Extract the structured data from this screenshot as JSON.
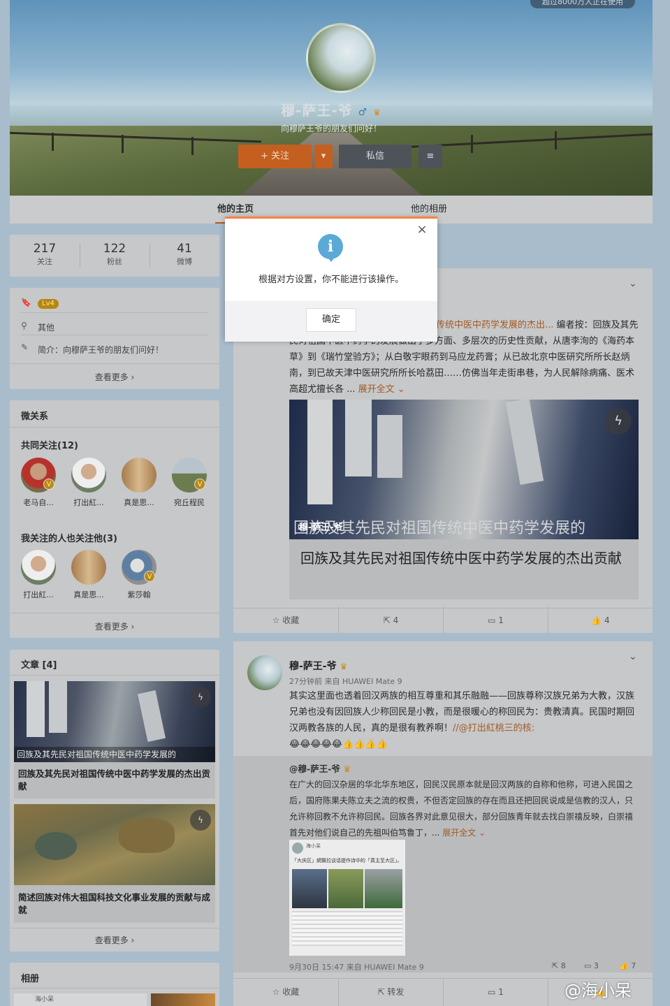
{
  "cover": {
    "top_badge": "超过8000万人正在使用",
    "username": "穆-萨王-爷",
    "gender_icon": "male-icon",
    "tagline": "向穆萨王爷的朋友们问好！",
    "follow_label": "+ 关注",
    "follow_dropdown": "▾",
    "message_label": "私信",
    "menu_label": "≡"
  },
  "tabs": [
    {
      "label": "他的主页"
    },
    {
      "label": "他的相册"
    }
  ],
  "stats": [
    {
      "value": "217",
      "label": "关注"
    },
    {
      "value": "122",
      "label": "粉丝"
    },
    {
      "value": "41",
      "label": "微博"
    }
  ],
  "info": {
    "level": "Lv4",
    "location": "其他",
    "bio": "简介：向穆萨王爷的朋友们问好！",
    "more": "查看更多 ›"
  },
  "relations": {
    "title": "微关系",
    "common_title": "共同关注(12)",
    "common": [
      {
        "name": "老马自..."
      },
      {
        "name": "打出紅..."
      },
      {
        "name": "真是思..."
      },
      {
        "name": "宛丘程民"
      }
    ],
    "mutual_title": "我关注的人也关注他(3)",
    "mutual": [
      {
        "name": "打出紅..."
      },
      {
        "name": "真是思..."
      },
      {
        "name": "紫莎翰"
      }
    ],
    "more": "查看更多 ›"
  },
  "articles": {
    "title": "文章 [4]",
    "items": [
      {
        "overlay": "回族及其先民对祖国传统中医中药学发展的",
        "title": "回族及其先民对祖国传统中医中药学发展的杰出贡献"
      },
      {
        "title": "简述回族对伟大祖国科技文化事业发展的贡献与成就"
      }
    ],
    "more": "查看更多 ›"
  },
  "album": {
    "title": "相册",
    "preview_name": "海小呆"
  },
  "post1": {
    "text_link": "传统中医中药学发展的杰出...",
    "text": "编者按：回族及其先民对祖国中医中药学的发展做出了多方面、多层次的历史性贡献，从唐李洵的《海药本草》到《瑞竹堂验方》；从白敬宇眼药到马应龙药膏；从已故北京中医研究所所长赵炳南，到已故天津中医研究所所长哈荔田……仿佛当年走街串巷，为人民解除病痛、医术高超尤擅长各 ...",
    "expand": "展开全文 ⌄",
    "card_overlay": "回族及其先民对祖国传统中医中药学发展的",
    "card_author": "穆-萨王-爷",
    "card_title": "回族及其先民对祖国传统中医中药学发展的杰出贡献",
    "actions": [
      {
        "label": "☆ 收藏"
      },
      {
        "label": "⇱ 4"
      },
      {
        "label": "▭ 1"
      },
      {
        "label": "👍 4"
      }
    ]
  },
  "post2": {
    "author": "穆-萨王-爷",
    "meta": "27分钟前 来自 HUAWEI Mate 9",
    "text": "其实这里面也透着回汉两族的相互尊重和其乐融融——回族尊称汉族兄弟为大教，汉族兄弟也没有因回族人少称回民是小教，而是很暖心的称回民为：贵教清真。民国时期回汉两教各族的人民，真的是很有教养啊！",
    "mention": "//@打出紅桃三的核:",
    "emoji": "😂😂😂😂😂👍👍👍👍",
    "repost_author": "@穆-萨王-爷",
    "repost_text": "在广大的回汉杂居的华北华东地区，回民汉民原本就是回汉两族的自称和他称，可进入民国之后，国府陈果夫陈立夫之流的权贵，不但否定回族的存在而且还把回民说成是信教的汉人，只允许称回教不允许称回民。回族各界对此意见很大，部分回族青年就去找白崇禧反映，白崇禧首先对他们说自己的先祖叫伯笃鲁丁，...",
    "repost_expand": "展开全文 ⌄",
    "repost_footer": "9月30日 15:47 来自 HUAWEI Mate 9",
    "repost_counts": [
      {
        "label": "⇱ 8"
      },
      {
        "label": "▭ 3"
      },
      {
        "label": "👍 7"
      }
    ],
    "shot_name": "海小呆",
    "shot_text": "「大庆区」網賢拉谈话提作诗中的「真主至大区」。",
    "actions": [
      {
        "label": "☆ 收藏"
      },
      {
        "label": "⇱ 转发"
      },
      {
        "label": "▭ 1"
      },
      {
        "label": "👍"
      }
    ]
  },
  "dialog": {
    "icon": "i",
    "message": "根据对方设置，你不能进行该操作。",
    "ok": "确定",
    "close": "×"
  },
  "watermark": "@海小呆",
  "colors": {
    "accent": "#ff8140",
    "follow": "#f7731f",
    "link": "#eb7350",
    "info": "#5aa9d6"
  }
}
